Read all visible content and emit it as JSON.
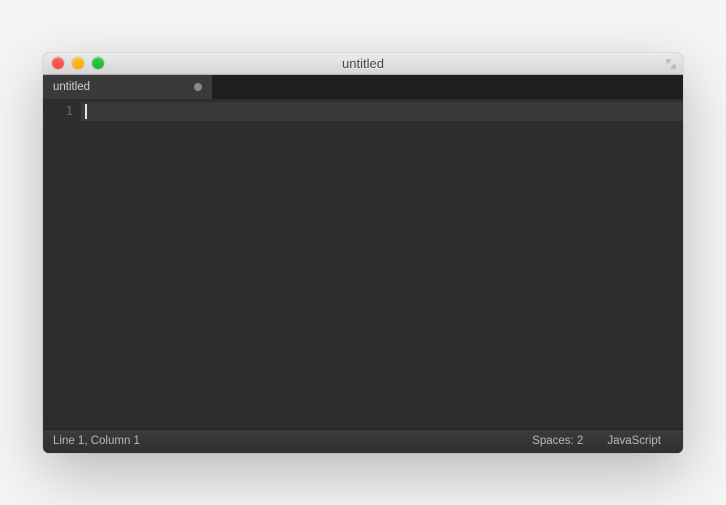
{
  "window": {
    "title": "untitled"
  },
  "tabs": [
    {
      "label": "untitled",
      "dirty": true
    }
  ],
  "gutter": {
    "line_numbers": [
      "1"
    ]
  },
  "editor": {
    "content": ""
  },
  "status_bar": {
    "cursor_position": "Line 1, Column 1",
    "indentation": "Spaces: 2",
    "syntax": "JavaScript"
  }
}
